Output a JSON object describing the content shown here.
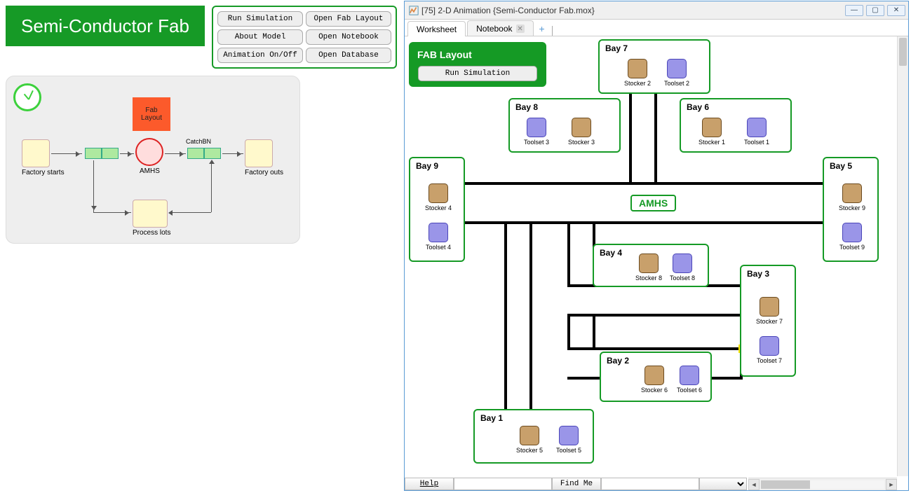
{
  "banner": {
    "title": "Semi-Conductor Fab"
  },
  "buttons": {
    "run_sim": "Run Simulation",
    "open_fab": "Open Fab Layout",
    "about": "About Model",
    "open_nb": "Open Notebook",
    "anim": "Animation On/Off",
    "open_db": "Open Database"
  },
  "model": {
    "fab_layout": "Fab\nLayout",
    "factory_starts": "Factory starts",
    "amhs": "AMHS",
    "catch": "CatchBN",
    "factory_outs": "Factory outs",
    "process_lots": "Process lots"
  },
  "window": {
    "title": "[75] 2-D Animation {Semi-Conductor Fab.mox}",
    "tabs": {
      "worksheet": "Worksheet",
      "notebook": "Notebook"
    }
  },
  "fab_panel": {
    "title": "FAB Layout",
    "run": "Run Simulation"
  },
  "amhs_label": "AMHS",
  "bays": {
    "b1": {
      "title": "Bay 1",
      "stocker": "Stocker 5",
      "toolset": "Toolset 5"
    },
    "b2": {
      "title": "Bay 2",
      "stocker": "Stocker 6",
      "toolset": "Toolset 6"
    },
    "b3": {
      "title": "Bay 3",
      "stocker": "Stocker 7",
      "toolset": "Toolset 7"
    },
    "b4": {
      "title": "Bay 4",
      "stocker": "Stocker 8",
      "toolset": "Toolset 8"
    },
    "b5": {
      "title": "Bay 5",
      "stocker": "Stocker 9",
      "toolset": "Toolset 9"
    },
    "b6": {
      "title": "Bay 6",
      "stocker": "Stocker 1",
      "toolset": "Toolset 1"
    },
    "b7": {
      "title": "Bay 7",
      "stocker": "Stocker 2",
      "toolset": "Toolset 2"
    },
    "b8": {
      "title": "Bay 8",
      "stocker": "Stocker 3",
      "toolset": "Toolset 3"
    },
    "b9": {
      "title": "Bay 9",
      "stocker": "Stocker 4",
      "toolset": "Toolset 4"
    }
  },
  "status": {
    "help": "Help",
    "findme": "Find Me"
  }
}
